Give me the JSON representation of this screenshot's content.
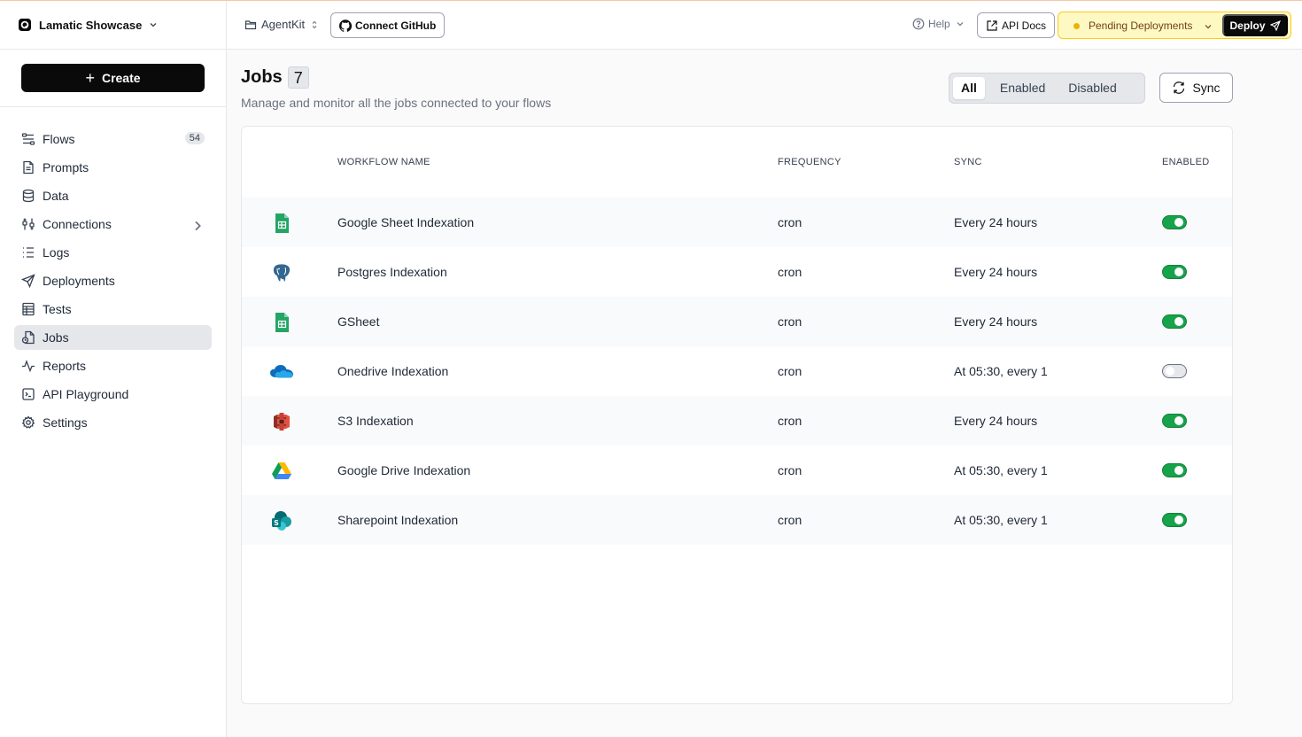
{
  "org": {
    "name": "Lamatic Showcase"
  },
  "sidebar": {
    "create_label": "Create",
    "items": [
      {
        "label": "Flows",
        "icon": "flows-icon",
        "badge": "54"
      },
      {
        "label": "Prompts",
        "icon": "file-text-icon"
      },
      {
        "label": "Data",
        "icon": "database-icon"
      },
      {
        "label": "Connections",
        "icon": "connections-icon"
      },
      {
        "label": "Logs",
        "icon": "list-icon"
      },
      {
        "label": "Deployments",
        "icon": "send-icon"
      },
      {
        "label": "Tests",
        "icon": "table-icon"
      },
      {
        "label": "Jobs",
        "icon": "jobs-icon",
        "active": true
      },
      {
        "label": "Reports",
        "icon": "activity-icon"
      },
      {
        "label": "API Playground",
        "icon": "terminal-icon"
      },
      {
        "label": "Settings",
        "icon": "gear-icon"
      }
    ]
  },
  "header": {
    "project": "AgentKit",
    "github_label": "Connect GitHub",
    "help_label": "Help",
    "api_docs_label": "API Docs",
    "pending_label": "Pending Deployments",
    "deploy_label": "Deploy"
  },
  "page": {
    "title": "Jobs",
    "count": "7",
    "subtitle": "Manage and monitor all the jobs connected to your flows",
    "filters": [
      "All",
      "Enabled",
      "Disabled"
    ],
    "active_filter": "All",
    "sync_label": "Sync"
  },
  "table": {
    "columns": [
      "WORKFLOW NAME",
      "FREQUENCY",
      "SYNC",
      "ENABLED"
    ],
    "rows": [
      {
        "icon": "google-sheets-icon",
        "name": "Google Sheet Indexation",
        "frequency": "cron",
        "sync": "Every 24 hours",
        "enabled": true
      },
      {
        "icon": "postgres-icon",
        "name": "Postgres Indexation",
        "frequency": "cron",
        "sync": "Every 24 hours",
        "enabled": true
      },
      {
        "icon": "google-sheets-icon",
        "name": "GSheet",
        "frequency": "cron",
        "sync": "Every 24 hours",
        "enabled": true
      },
      {
        "icon": "onedrive-icon",
        "name": "Onedrive Indexation",
        "frequency": "cron",
        "sync": "At 05:30, every 1",
        "enabled": false
      },
      {
        "icon": "aws-s3-icon",
        "name": "S3 Indexation",
        "frequency": "cron",
        "sync": "Every 24 hours",
        "enabled": true
      },
      {
        "icon": "google-drive-icon",
        "name": "Google Drive Indexation",
        "frequency": "cron",
        "sync": "At 05:30, every 1",
        "enabled": true
      },
      {
        "icon": "sharepoint-icon",
        "name": "Sharepoint Indexation",
        "frequency": "cron",
        "sync": "At 05:30, every 1",
        "enabled": true
      }
    ]
  },
  "colors": {
    "toggle_on": "#16a34a",
    "pending_bg": "#fef9c3",
    "pending_dot": "#eab308",
    "primary_button": "#0a0a0a"
  }
}
